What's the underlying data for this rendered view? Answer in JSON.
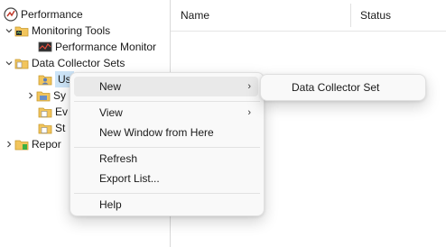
{
  "tree": {
    "items": [
      {
        "label": "Performance",
        "icon": "performance-icon",
        "expander": ""
      },
      {
        "label": "Monitoring Tools",
        "icon": "folder-icon",
        "expander": "collapse"
      },
      {
        "label": "Performance Monitor",
        "icon": "performance-monitor-icon",
        "expander": ""
      },
      {
        "label": "Data Collector Sets",
        "icon": "folder-icon",
        "expander": "collapse"
      },
      {
        "label": "Us",
        "icon": "user-set-icon",
        "expander": ""
      },
      {
        "label": "Sy",
        "icon": "system-set-icon",
        "expander": "expand"
      },
      {
        "label": "Ev",
        "icon": "event-set-icon",
        "expander": ""
      },
      {
        "label": "St",
        "icon": "startup-set-icon",
        "expander": ""
      },
      {
        "label": "Repor",
        "icon": "reports-icon",
        "expander": "expand"
      }
    ]
  },
  "list": {
    "columns": [
      "Name",
      "Status"
    ]
  },
  "context_menu": {
    "items": [
      {
        "label": "New",
        "arrow": "›"
      },
      {
        "label": "View",
        "arrow": "›"
      },
      {
        "label": "New Window from Here",
        "arrow": ""
      },
      {
        "label": "Refresh",
        "arrow": ""
      },
      {
        "label": "Export List...",
        "arrow": ""
      },
      {
        "label": "Help",
        "arrow": ""
      }
    ]
  },
  "submenu": {
    "items": [
      {
        "label": "Data Collector Set"
      }
    ]
  },
  "colors": {
    "selection": "#cce4f7",
    "menu_bg": "#f9f9f9",
    "menu_hot": "#e9e9e9",
    "folder": "#f2c55c"
  }
}
